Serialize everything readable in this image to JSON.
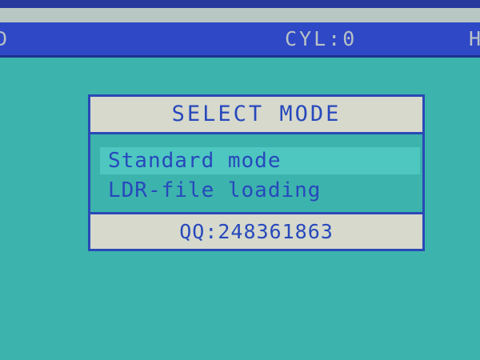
{
  "status_bar": {
    "left_text": "D",
    "cylinder": "CYL:0",
    "right_text": "H"
  },
  "dialog": {
    "title": "SELECT MODE",
    "items": [
      {
        "label": "Standard mode",
        "selected": true
      },
      {
        "label": "LDR-file loading",
        "selected": false
      }
    ],
    "footer": "QQ:248361863"
  },
  "colors": {
    "background": "#3db3ad",
    "status_bar": "#2f48c6",
    "dialog_panel": "#d6d9cc",
    "dialog_text": "#2748bc",
    "selection_highlight": "#4ec7c0"
  }
}
